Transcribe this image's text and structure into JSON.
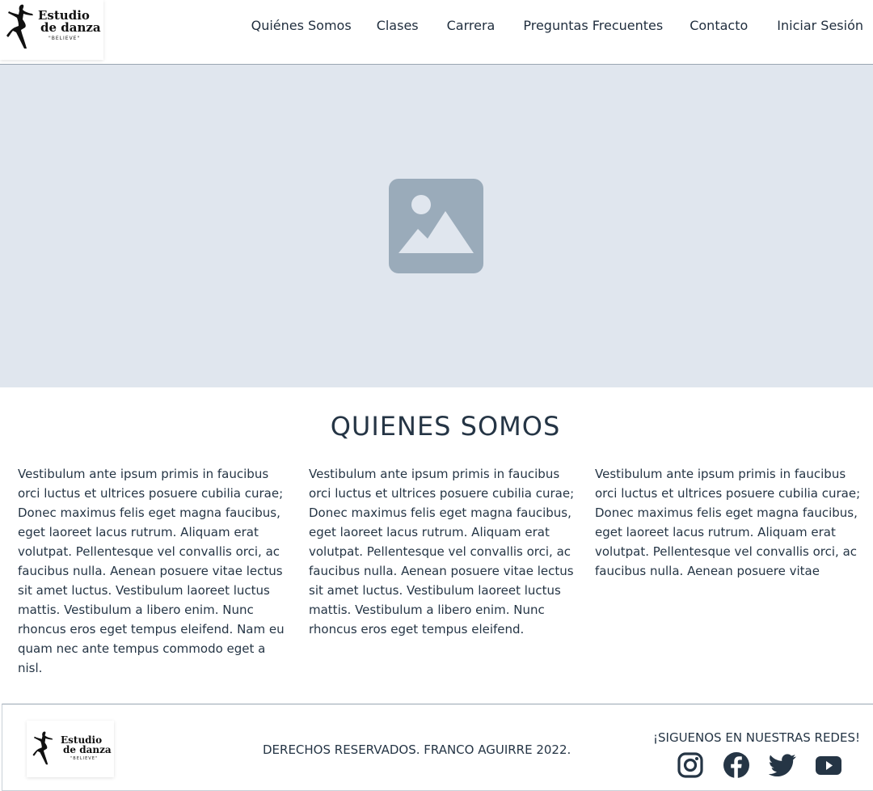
{
  "brand": {
    "line1": "Estudio",
    "line2": "de danza",
    "tagline": "\"BELIEVE\""
  },
  "nav": [
    {
      "label": "Quiénes Somos"
    },
    {
      "label": "Clases"
    },
    {
      "label": "Carrera"
    },
    {
      "label": "Preguntas Frecuentes"
    },
    {
      "label": "Contacto"
    },
    {
      "label": "Iniciar Sesión"
    }
  ],
  "hero": {
    "icon": "image-placeholder-icon"
  },
  "about": {
    "title": "QUIENES SOMOS",
    "columns": [
      "Vestibulum ante ipsum primis in faucibus orci luctus et ultrices posuere cubilia curae; Donec maximus felis eget magna faucibus, eget laoreet lacus rutrum. Aliquam erat volutpat. Pellentesque vel convallis orci, ac faucibus nulla. Aenean posuere vitae lectus sit amet luctus. Vestibulum laoreet luctus mattis. Vestibulum a libero enim. Nunc rhoncus eros eget tempus eleifend. Nam eu quam nec ante tempus commodo eget a nisl.",
      "Vestibulum ante ipsum primis in faucibus orci luctus et ultrices posuere cubilia curae; Donec maximus felis eget magna faucibus, eget laoreet lacus rutrum. Aliquam erat volutpat. Pellentesque vel convallis orci, ac faucibus nulla. Aenean posuere vitae lectus sit amet luctus. Vestibulum laoreet luctus mattis. Vestibulum a libero enim. Nunc rhoncus eros eget tempus eleifend.",
      "Vestibulum ante ipsum primis in faucibus orci luctus et ultrices posuere cubilia curae; Donec maximus felis eget magna faucibus, eget laoreet lacus rutrum. Aliquam erat volutpat. Pellentesque vel convallis orci, ac faucibus nulla. Aenean posuere vitae"
    ]
  },
  "footer": {
    "copyright": "DERECHOS RESERVADOS. FRANCO AGUIRRE 2022.",
    "social_title": "¡SIGUENOS EN NUESTRAS REDES!",
    "social": [
      {
        "icon": "instagram-icon"
      },
      {
        "icon": "facebook-icon"
      },
      {
        "icon": "twitter-icon"
      },
      {
        "icon": "youtube-icon"
      }
    ]
  },
  "colors": {
    "text": "#253545",
    "hero_bg": "#e0e6ee",
    "placeholder_icon": "#9aabba",
    "divider": "#9aa6b2"
  }
}
